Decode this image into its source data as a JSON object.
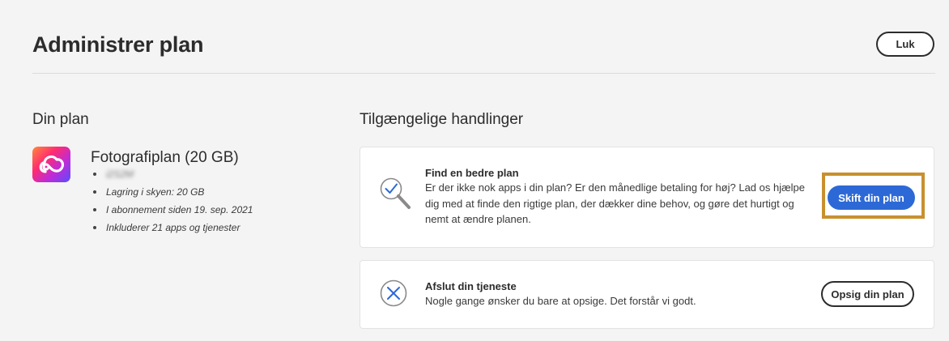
{
  "header": {
    "title": "Administrer plan",
    "close_label": "Luk"
  },
  "left": {
    "heading": "Din plan",
    "app_icon": "creative-cloud-icon",
    "plan_name": "Fotografiplan (20 GB)",
    "details": [
      "i2S2M",
      "Lagring i skyen: 20 GB",
      "I abonnement siden 19. sep. 2021",
      "Inkluderer 21 apps og tjenester"
    ]
  },
  "right": {
    "heading": "Tilgængelige handlinger",
    "cards": [
      {
        "icon": "magnifier-check-icon",
        "title": "Find en bedre plan",
        "lines": [
          "Er der ikke nok apps i din plan? Er den månedlige betaling for høj? Lad os hjælpe",
          "dig med at finde den rigtige plan, der dækker dine behov, og gøre det hurtigt og",
          "nemt at ændre planen."
        ],
        "button_label": "Skift din plan",
        "highlight_color": "#c8902d"
      },
      {
        "icon": "close-circle-icon",
        "title": "Afslut din tjeneste",
        "lines": [
          "Nogle gange ønsker du bare at opsige. Det forstår vi godt."
        ],
        "button_label": "Opsig din plan"
      }
    ]
  },
  "colors": {
    "background": "#f4f4f4",
    "accent": "#2d69d6",
    "text": "#2c2c2c"
  }
}
